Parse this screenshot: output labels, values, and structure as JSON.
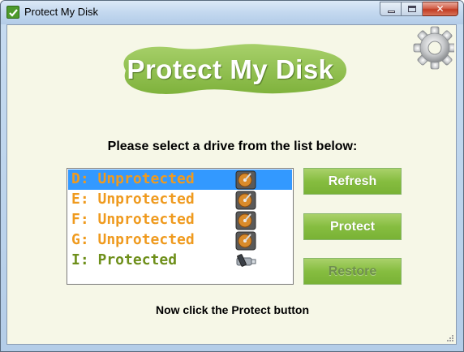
{
  "window": {
    "title": "Protect My Disk",
    "app_icon": "green-check-shield-icon",
    "caption_buttons": [
      "minimize",
      "maximize",
      "close"
    ],
    "close_glyph": "✕"
  },
  "header": {
    "logo_text": "Protect My Disk",
    "settings_icon": "gear-icon"
  },
  "main": {
    "instruction": "Please select a drive from the list below:",
    "drives": [
      {
        "label": "D: Unprotected",
        "state": "unprotected",
        "icon": "hard-disk-icon",
        "selected": true
      },
      {
        "label": "E: Unprotected",
        "state": "unprotected",
        "icon": "hard-disk-icon",
        "selected": false
      },
      {
        "label": "F: Unprotected",
        "state": "unprotected",
        "icon": "hard-disk-icon",
        "selected": false
      },
      {
        "label": "G: Unprotected",
        "state": "unprotected",
        "icon": "hard-disk-icon",
        "selected": false
      },
      {
        "label": "I: Protected",
        "state": "protected",
        "icon": "usb-drive-icon",
        "selected": false
      }
    ],
    "buttons": {
      "refresh": "Refresh",
      "protect": "Protect",
      "restore": "Restore"
    },
    "status": "Now click the Protect button"
  },
  "colors": {
    "unprotected": "#ef9a1e",
    "protected": "#6e8f1a",
    "selection": "#3399ff",
    "button_green": "#86bd40",
    "logo_green": "#8dbf52"
  }
}
